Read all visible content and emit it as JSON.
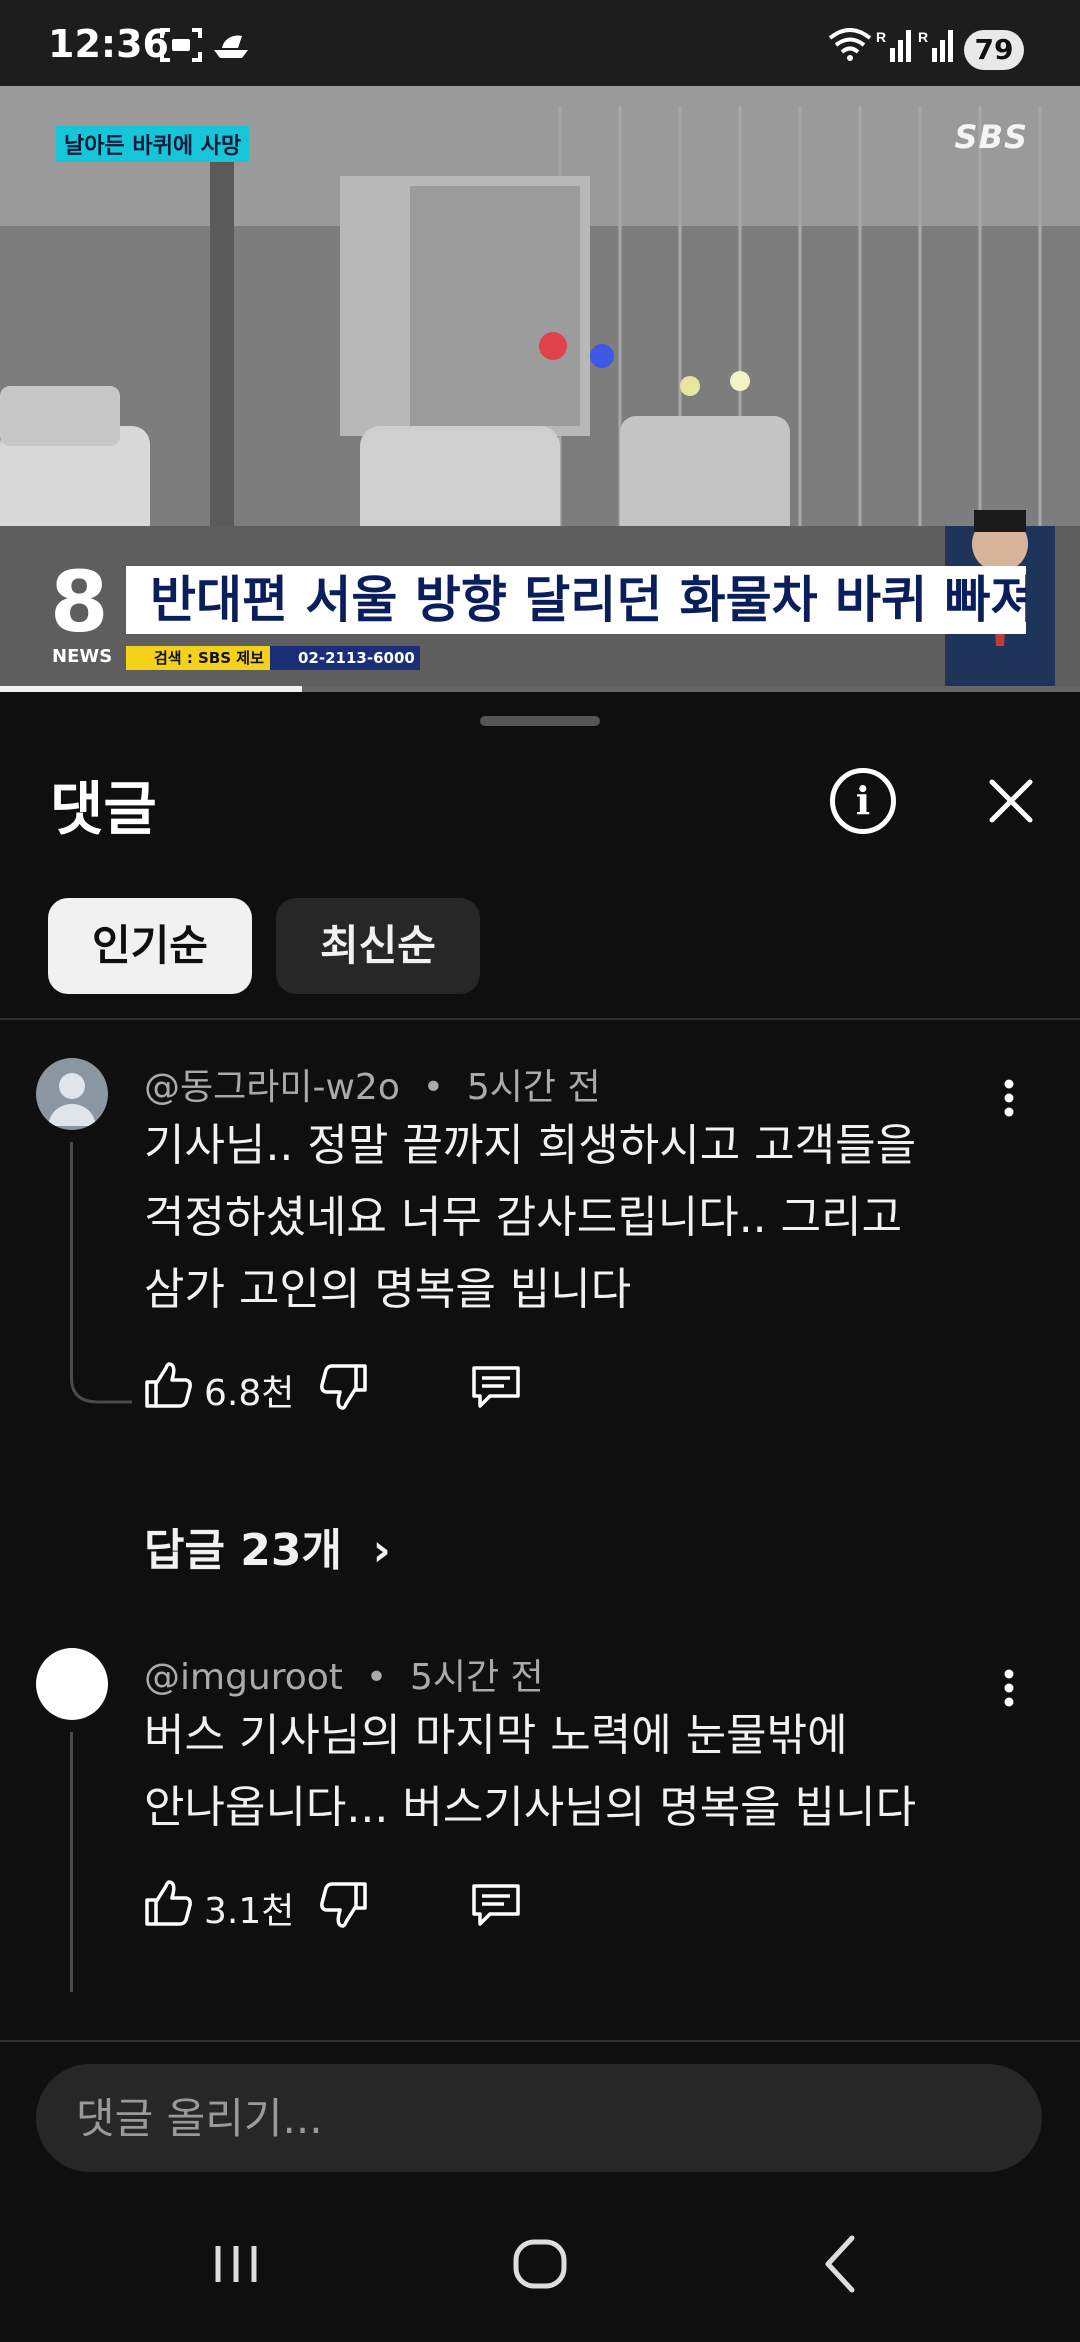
{
  "status_bar": {
    "time": "12:36",
    "battery": "79",
    "icons": [
      "screenshot-icon",
      "boat-icon",
      "wifi-icon",
      "signal-r-icon",
      "signal-r-icon"
    ]
  },
  "video": {
    "tag": "날아든 바퀴에 사망",
    "channel_logo": "SBS",
    "headline": "반대편 서울 방향 달리던 화물차 바퀴 빠져",
    "program_logo": "8",
    "program_sublabel": "NEWS",
    "search_tag": "검색 : SBS 제보",
    "phone_tag": "02-2113-6000",
    "progress": 0.28
  },
  "sheet": {
    "title": "댓글",
    "filters": [
      {
        "label": "인기순",
        "active": true
      },
      {
        "label": "최신순",
        "active": false
      }
    ]
  },
  "comments": [
    {
      "author": "@동그라미-w2o",
      "time": "5시간 전",
      "lines": [
        "기사님.. 정말 끝까지 희생하시고 고객들을",
        "걱정하셨네요 너무 감사드립니다.. 그리고",
        "삼가 고인의 명복을 빕니다"
      ],
      "likes": "6.8천",
      "replies": "답글 23개"
    },
    {
      "author": "@imguroot",
      "time": "5시간 전",
      "lines": [
        "버스 기사님의 마지막 노력에 눈물밖에",
        "안나옵니다... 버스기사님의 명복을 빕니다"
      ],
      "likes": "3.1천"
    }
  ],
  "composer": {
    "placeholder": "댓글 올리기..."
  },
  "colors": {
    "background": "#0f0f0f",
    "chip_active": "#f1f1f1",
    "chip_idle": "#272727",
    "headline_text": "#0b1e5c",
    "tag_bg": "#16c6d8"
  }
}
